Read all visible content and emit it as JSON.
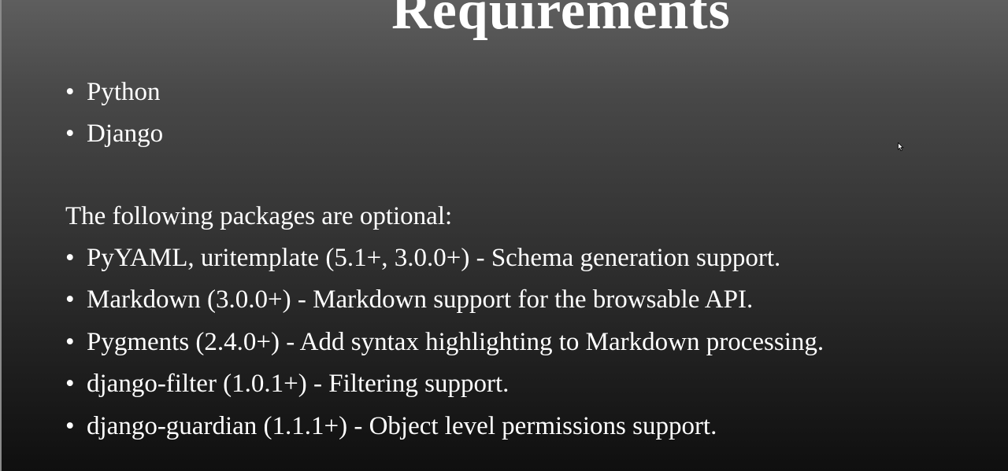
{
  "slide": {
    "title": "Requirements",
    "required_items": [
      "Python",
      "Django"
    ],
    "optional_intro": "The following packages are optional:",
    "optional_items": [
      "PyYAML, uritemplate (5.1+, 3.0.0+) - Schema generation support.",
      "Markdown (3.0.0+) - Markdown support for the browsable API.",
      "Pygments (2.4.0+) - Add syntax highlighting to Markdown processing.",
      "django-filter (1.0.1+) - Filtering support.",
      "django-guardian (1.1.1+) - Object level permissions support."
    ],
    "bullet_glyph": "•"
  },
  "cursor_icon": "mouse-pointer-icon"
}
